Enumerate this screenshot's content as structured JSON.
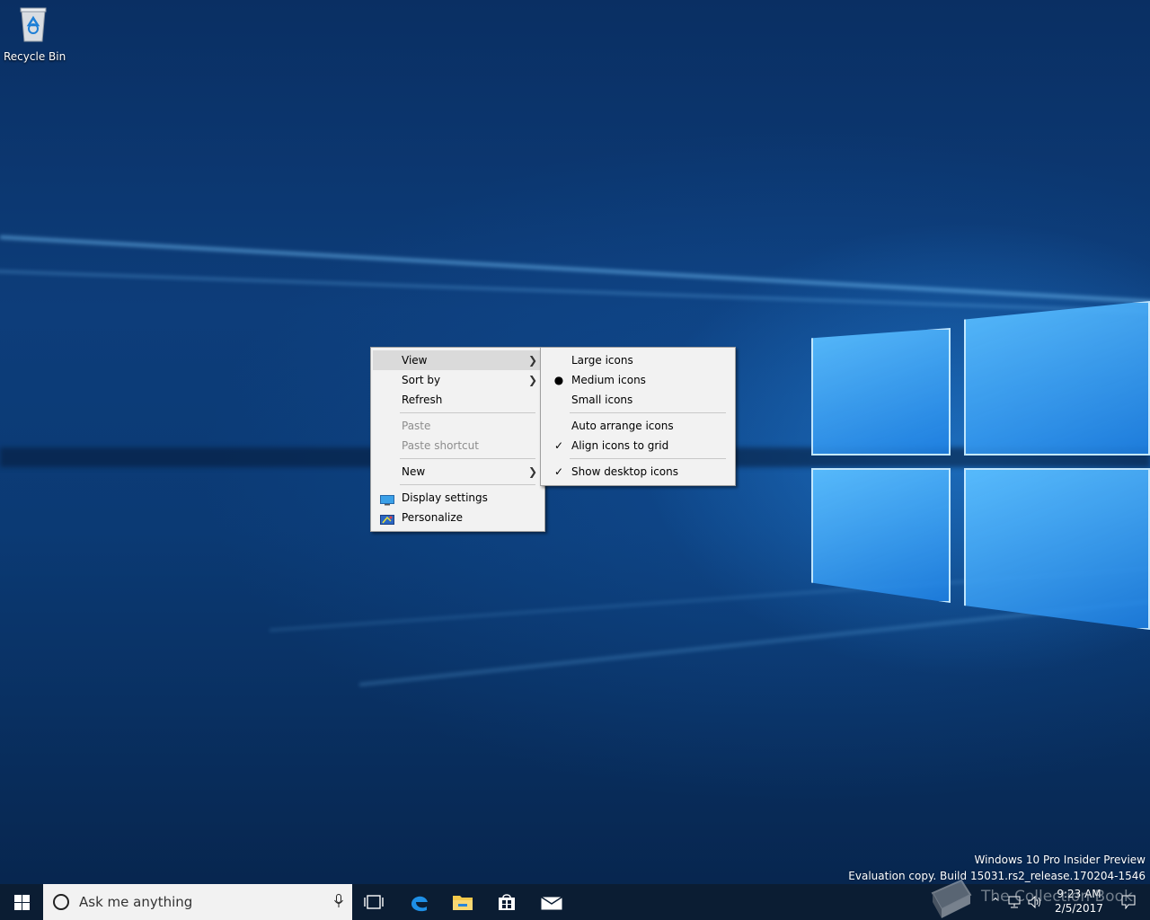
{
  "desktop": {
    "icons": [
      {
        "label": "Recycle Bin",
        "icon": "recycle-bin-icon"
      }
    ],
    "watermark": {
      "line1": "Windows 10 Pro Insider Preview",
      "line2": "Evaluation copy. Build 15031.rs2_release.170204-1546"
    }
  },
  "context_menu": {
    "items": [
      {
        "label": "View",
        "submenu": true,
        "highlighted": true
      },
      {
        "label": "Sort by",
        "submenu": true
      },
      {
        "label": "Refresh"
      },
      {
        "label": "Paste",
        "disabled": true
      },
      {
        "label": "Paste shortcut",
        "disabled": true
      },
      {
        "label": "New",
        "submenu": true
      },
      {
        "label": "Display settings",
        "icon": "display-icon"
      },
      {
        "label": "Personalize",
        "icon": "personalize-icon"
      }
    ]
  },
  "view_submenu": {
    "items": [
      {
        "label": "Large icons"
      },
      {
        "label": "Medium icons",
        "mark": "bullet"
      },
      {
        "label": "Small icons"
      },
      {
        "label": "Auto arrange icons"
      },
      {
        "label": "Align icons to grid",
        "mark": "check"
      },
      {
        "label": "Show desktop icons",
        "mark": "check"
      }
    ]
  },
  "taskbar": {
    "search_placeholder": "Ask me anything",
    "pinned": [
      "task-view-icon",
      "edge-icon",
      "file-explorer-icon",
      "store-icon",
      "mail-icon"
    ],
    "clock": {
      "time": "9:23 AM",
      "date": "2/5/2017"
    },
    "overlay_text": "The Collection Book"
  },
  "colors": {
    "taskbar": "#0b1d33",
    "menu_bg": "#f2f2f2",
    "menu_hover": "#dadada",
    "accent": "#0078d7"
  }
}
